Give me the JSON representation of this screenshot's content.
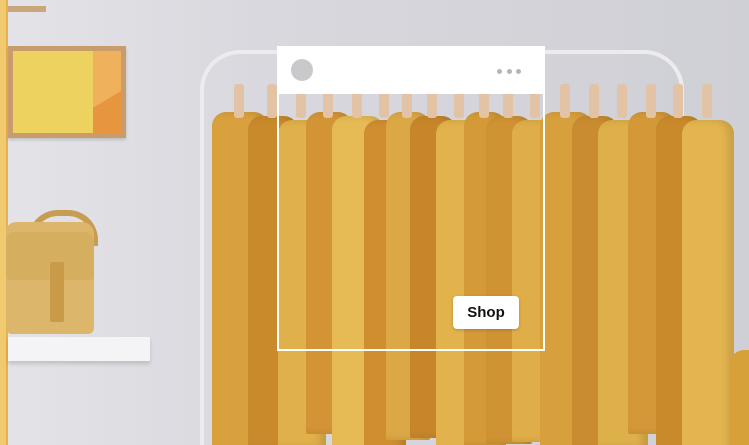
{
  "shop_button": {
    "label": "Shop"
  },
  "post_header": {
    "avatar_icon": "avatar-placeholder",
    "menu_icon": "more-horizontal-icon"
  },
  "colors": {
    "wall": "#d8d7dc",
    "accent_yellow": "#f1c96e",
    "garment_mustard": "#d9a13d",
    "overlay_border": "#ffffff"
  }
}
